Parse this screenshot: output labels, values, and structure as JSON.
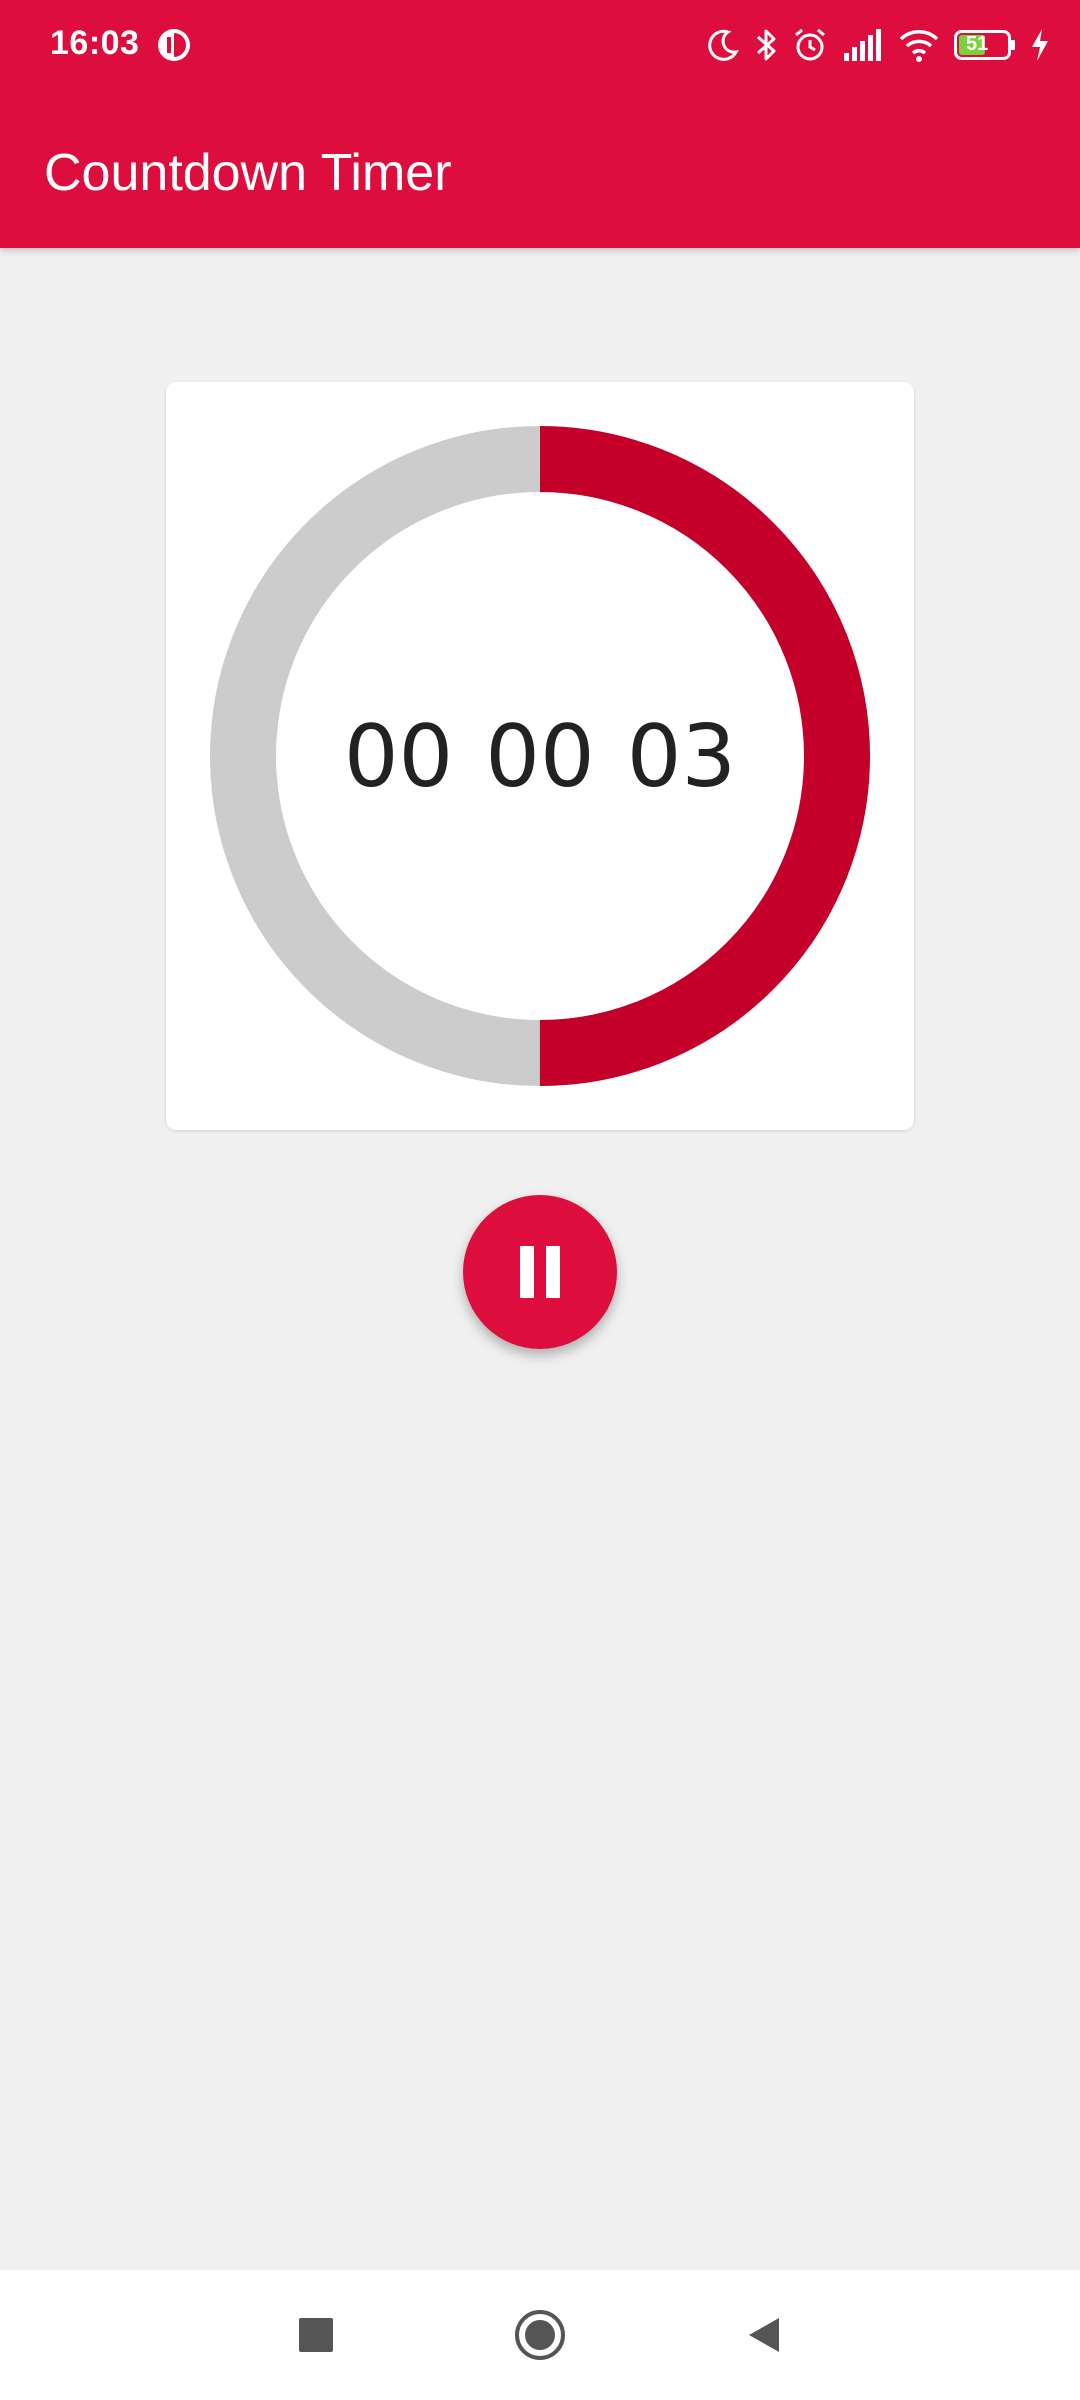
{
  "status_bar": {
    "time": "16:03",
    "battery_level": "51",
    "icons": [
      "app-notification-icon",
      "moon-icon",
      "bluetooth-icon",
      "alarm-icon",
      "signal-icon",
      "wifi-icon",
      "battery-icon",
      "charging-icon"
    ]
  },
  "app_bar": {
    "title": "Countdown Timer"
  },
  "timer": {
    "hours": "00",
    "minutes": "00",
    "seconds": "03",
    "progress_fraction": 0.5
  },
  "controls": {
    "fab_icon": "pause-icon"
  },
  "nav_bar": {
    "icons": [
      "recents-square-icon",
      "home-circle-icon",
      "back-triangle-icon"
    ]
  },
  "colors": {
    "primary": "#dd0e3e",
    "ring_progress": "#c4002a",
    "ring_track": "#cccccc",
    "background": "#f0f0f0"
  }
}
